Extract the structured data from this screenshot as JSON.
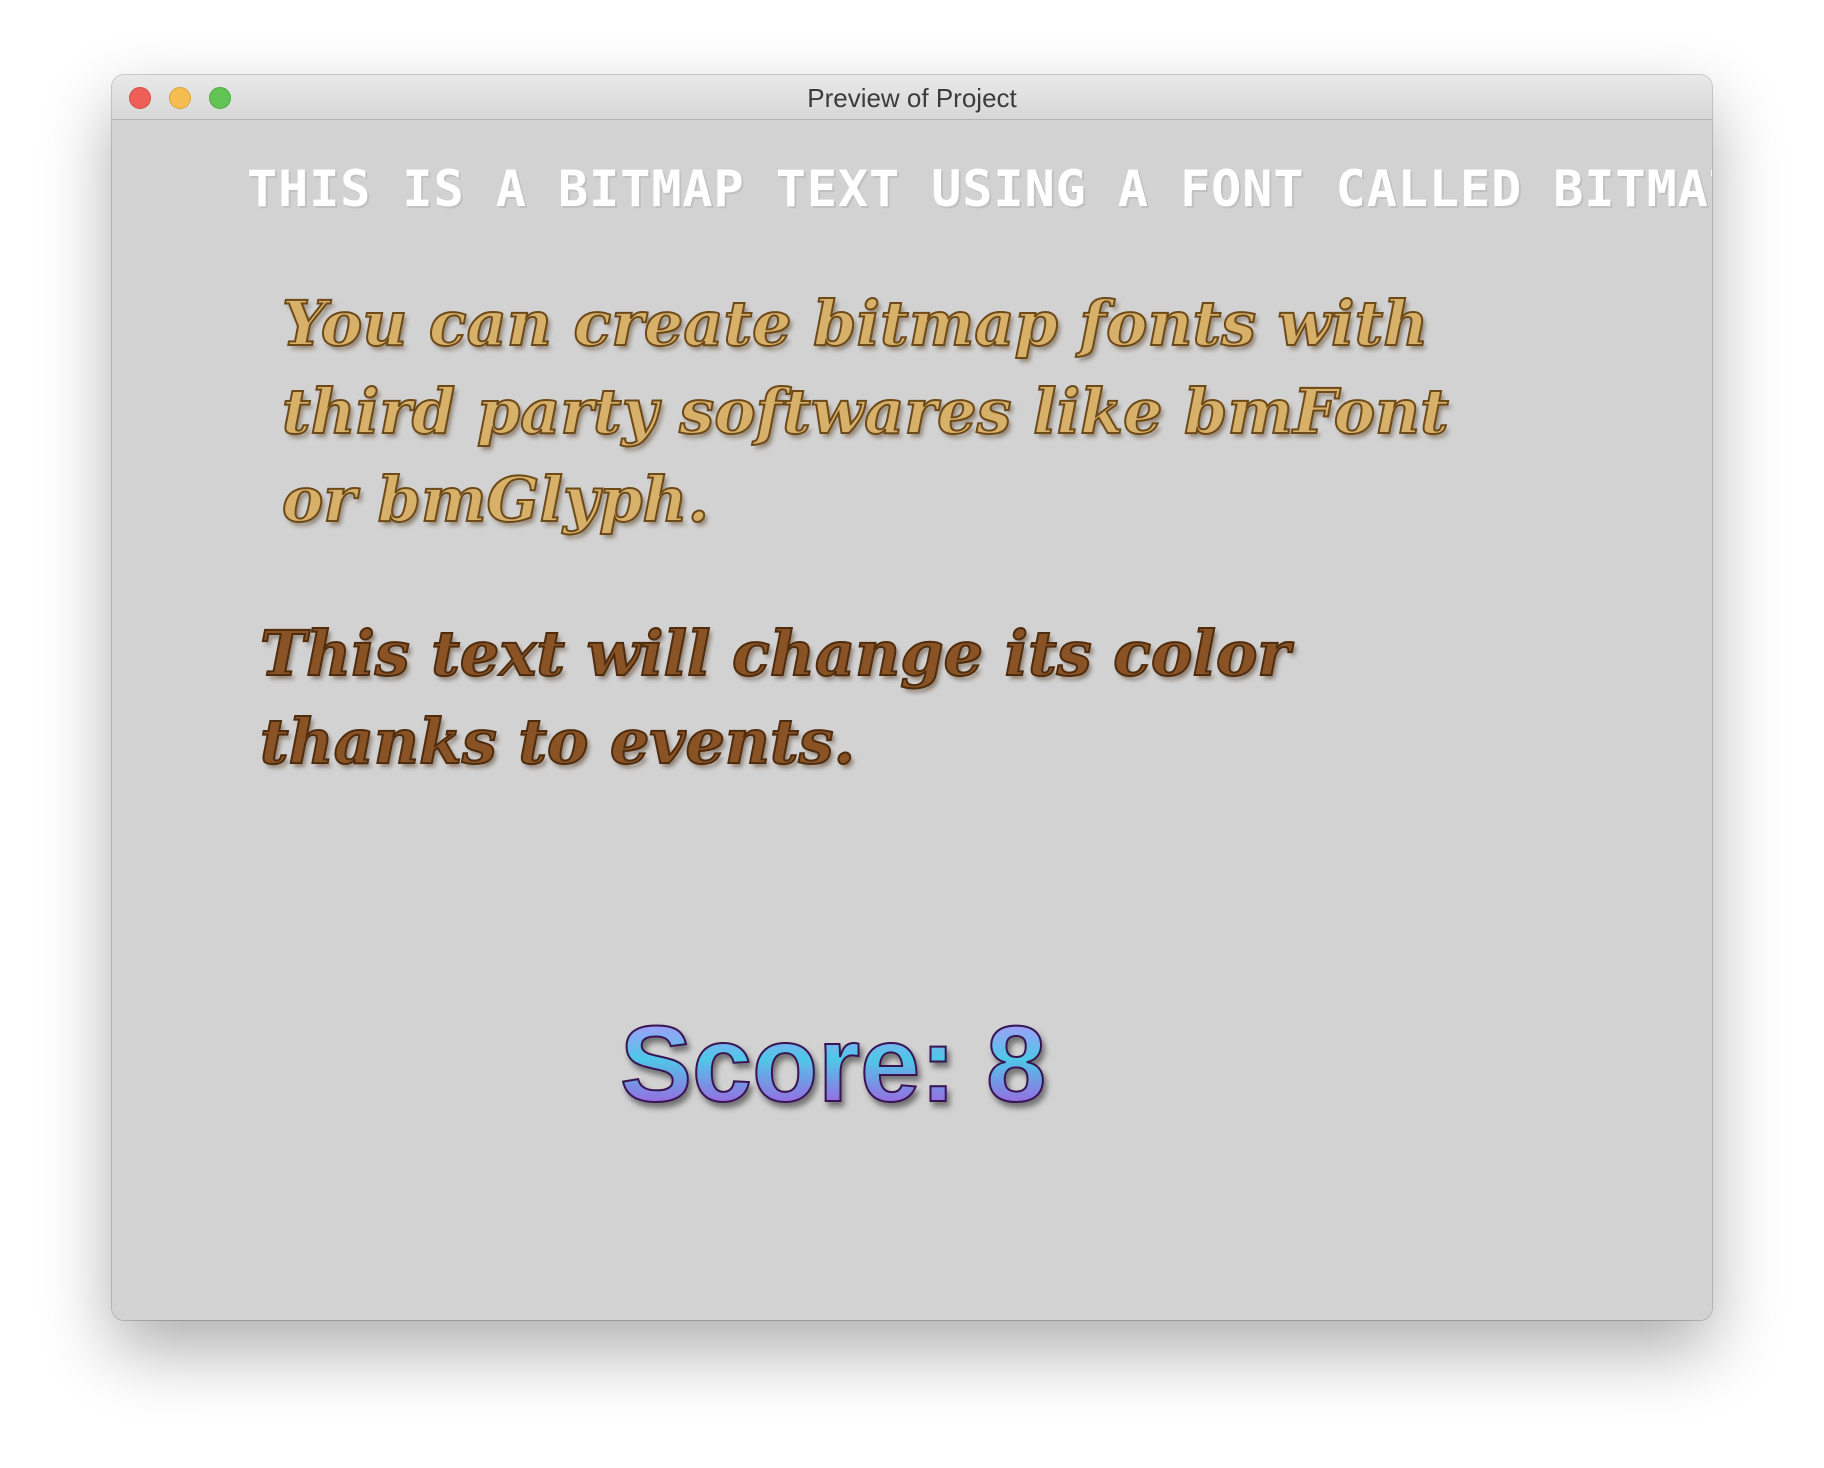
{
  "window": {
    "title": "Preview of Project"
  },
  "scene": {
    "bitmap_text": "THIS IS A BITMAP TEXT USING A FONT CALLED BITMATT.",
    "gold_text": "You can create bitmap fonts with third party softwares like bmFont or bmGlyph.",
    "brown_text": "This text will change its color thanks to events.",
    "score_text": "Score: 8"
  },
  "colors": {
    "background": "#d2d2d2",
    "bitmap_text": "#ffffff",
    "gold_text": "#d7b06a",
    "brown_text": "#8a5326",
    "score_gradient_top": "#c38cff",
    "score_gradient_mid": "#4ec8e8"
  }
}
